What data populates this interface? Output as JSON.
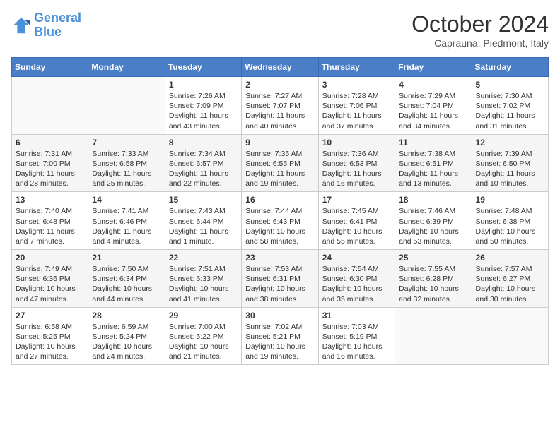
{
  "header": {
    "logo_line1": "General",
    "logo_line2": "Blue",
    "month": "October 2024",
    "location": "Caprauna, Piedmont, Italy"
  },
  "days_of_week": [
    "Sunday",
    "Monday",
    "Tuesday",
    "Wednesday",
    "Thursday",
    "Friday",
    "Saturday"
  ],
  "weeks": [
    [
      {
        "day": "",
        "text": ""
      },
      {
        "day": "",
        "text": ""
      },
      {
        "day": "1",
        "text": "Sunrise: 7:26 AM\nSunset: 7:09 PM\nDaylight: 11 hours and 43 minutes."
      },
      {
        "day": "2",
        "text": "Sunrise: 7:27 AM\nSunset: 7:07 PM\nDaylight: 11 hours and 40 minutes."
      },
      {
        "day": "3",
        "text": "Sunrise: 7:28 AM\nSunset: 7:06 PM\nDaylight: 11 hours and 37 minutes."
      },
      {
        "day": "4",
        "text": "Sunrise: 7:29 AM\nSunset: 7:04 PM\nDaylight: 11 hours and 34 minutes."
      },
      {
        "day": "5",
        "text": "Sunrise: 7:30 AM\nSunset: 7:02 PM\nDaylight: 11 hours and 31 minutes."
      }
    ],
    [
      {
        "day": "6",
        "text": "Sunrise: 7:31 AM\nSunset: 7:00 PM\nDaylight: 11 hours and 28 minutes."
      },
      {
        "day": "7",
        "text": "Sunrise: 7:33 AM\nSunset: 6:58 PM\nDaylight: 11 hours and 25 minutes."
      },
      {
        "day": "8",
        "text": "Sunrise: 7:34 AM\nSunset: 6:57 PM\nDaylight: 11 hours and 22 minutes."
      },
      {
        "day": "9",
        "text": "Sunrise: 7:35 AM\nSunset: 6:55 PM\nDaylight: 11 hours and 19 minutes."
      },
      {
        "day": "10",
        "text": "Sunrise: 7:36 AM\nSunset: 6:53 PM\nDaylight: 11 hours and 16 minutes."
      },
      {
        "day": "11",
        "text": "Sunrise: 7:38 AM\nSunset: 6:51 PM\nDaylight: 11 hours and 13 minutes."
      },
      {
        "day": "12",
        "text": "Sunrise: 7:39 AM\nSunset: 6:50 PM\nDaylight: 11 hours and 10 minutes."
      }
    ],
    [
      {
        "day": "13",
        "text": "Sunrise: 7:40 AM\nSunset: 6:48 PM\nDaylight: 11 hours and 7 minutes."
      },
      {
        "day": "14",
        "text": "Sunrise: 7:41 AM\nSunset: 6:46 PM\nDaylight: 11 hours and 4 minutes."
      },
      {
        "day": "15",
        "text": "Sunrise: 7:43 AM\nSunset: 6:44 PM\nDaylight: 11 hours and 1 minute."
      },
      {
        "day": "16",
        "text": "Sunrise: 7:44 AM\nSunset: 6:43 PM\nDaylight: 10 hours and 58 minutes."
      },
      {
        "day": "17",
        "text": "Sunrise: 7:45 AM\nSunset: 6:41 PM\nDaylight: 10 hours and 55 minutes."
      },
      {
        "day": "18",
        "text": "Sunrise: 7:46 AM\nSunset: 6:39 PM\nDaylight: 10 hours and 53 minutes."
      },
      {
        "day": "19",
        "text": "Sunrise: 7:48 AM\nSunset: 6:38 PM\nDaylight: 10 hours and 50 minutes."
      }
    ],
    [
      {
        "day": "20",
        "text": "Sunrise: 7:49 AM\nSunset: 6:36 PM\nDaylight: 10 hours and 47 minutes."
      },
      {
        "day": "21",
        "text": "Sunrise: 7:50 AM\nSunset: 6:34 PM\nDaylight: 10 hours and 44 minutes."
      },
      {
        "day": "22",
        "text": "Sunrise: 7:51 AM\nSunset: 6:33 PM\nDaylight: 10 hours and 41 minutes."
      },
      {
        "day": "23",
        "text": "Sunrise: 7:53 AM\nSunset: 6:31 PM\nDaylight: 10 hours and 38 minutes."
      },
      {
        "day": "24",
        "text": "Sunrise: 7:54 AM\nSunset: 6:30 PM\nDaylight: 10 hours and 35 minutes."
      },
      {
        "day": "25",
        "text": "Sunrise: 7:55 AM\nSunset: 6:28 PM\nDaylight: 10 hours and 32 minutes."
      },
      {
        "day": "26",
        "text": "Sunrise: 7:57 AM\nSunset: 6:27 PM\nDaylight: 10 hours and 30 minutes."
      }
    ],
    [
      {
        "day": "27",
        "text": "Sunrise: 6:58 AM\nSunset: 5:25 PM\nDaylight: 10 hours and 27 minutes."
      },
      {
        "day": "28",
        "text": "Sunrise: 6:59 AM\nSunset: 5:24 PM\nDaylight: 10 hours and 24 minutes."
      },
      {
        "day": "29",
        "text": "Sunrise: 7:00 AM\nSunset: 5:22 PM\nDaylight: 10 hours and 21 minutes."
      },
      {
        "day": "30",
        "text": "Sunrise: 7:02 AM\nSunset: 5:21 PM\nDaylight: 10 hours and 19 minutes."
      },
      {
        "day": "31",
        "text": "Sunrise: 7:03 AM\nSunset: 5:19 PM\nDaylight: 10 hours and 16 minutes."
      },
      {
        "day": "",
        "text": ""
      },
      {
        "day": "",
        "text": ""
      }
    ]
  ]
}
